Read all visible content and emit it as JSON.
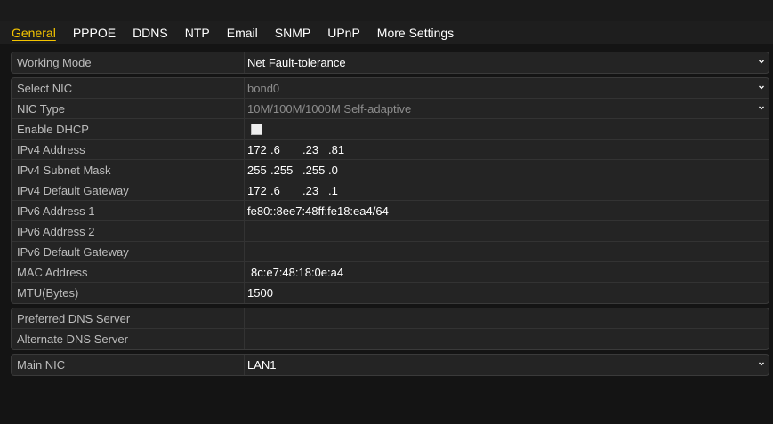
{
  "tabs": [
    "General",
    "PPPOE",
    "DDNS",
    "NTP",
    "Email",
    "SNMP",
    "UPnP",
    "More Settings"
  ],
  "active_tab": "General",
  "rows": {
    "working_mode": {
      "label": "Working Mode",
      "value": "Net Fault-tolerance"
    },
    "select_nic": {
      "label": "Select NIC",
      "value": "bond0"
    },
    "nic_type": {
      "label": "NIC Type",
      "value": "10M/100M/1000M Self-adaptive"
    },
    "enable_dhcp": {
      "label": "Enable DHCP",
      "checked": false
    },
    "ipv4_address": {
      "label": "IPv4 Address",
      "octets": [
        "172",
        ".6",
        ".23",
        ".81"
      ]
    },
    "ipv4_subnet_mask": {
      "label": "IPv4 Subnet Mask",
      "octets": [
        "255",
        ".255",
        ".255",
        ".0"
      ]
    },
    "ipv4_default_gateway": {
      "label": "IPv4 Default Gateway",
      "octets": [
        "172",
        ".6",
        ".23",
        ".1"
      ]
    },
    "ipv6_address_1": {
      "label": "IPv6 Address 1",
      "value": "fe80::8ee7:48ff:fe18:ea4/64"
    },
    "ipv6_address_2": {
      "label": "IPv6 Address 2",
      "value": ""
    },
    "ipv6_default_gateway": {
      "label": "IPv6 Default Gateway",
      "value": ""
    },
    "mac_address": {
      "label": "MAC Address",
      "value": "8c:e7:48:18:0e:a4"
    },
    "mtu": {
      "label": "MTU(Bytes)",
      "value": "1500"
    },
    "preferred_dns": {
      "label": "Preferred DNS Server",
      "value": ""
    },
    "alternate_dns": {
      "label": "Alternate DNS Server",
      "value": ""
    },
    "main_nic": {
      "label": "Main NIC",
      "value": "LAN1"
    }
  }
}
